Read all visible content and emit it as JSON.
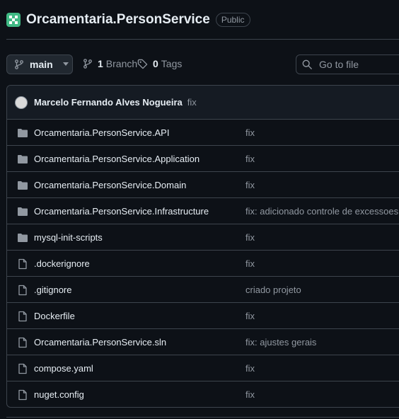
{
  "repo": {
    "name": "Orcamentaria.PersonService",
    "visibility": "Public",
    "avatar_color": "#3fb984"
  },
  "toolbar": {
    "branch_name": "main",
    "branch_count": "1",
    "branch_label": "Branch",
    "tag_count": "0",
    "tag_label": "Tags",
    "search_placeholder": "Go to file"
  },
  "latest_commit": {
    "author": "Marcelo Fernando Alves Nogueira",
    "message": "fix"
  },
  "files": [
    {
      "type": "folder",
      "name": "Orcamentaria.PersonService.API",
      "message": "fix"
    },
    {
      "type": "folder",
      "name": "Orcamentaria.PersonService.Application",
      "message": "fix"
    },
    {
      "type": "folder",
      "name": "Orcamentaria.PersonService.Domain",
      "message": "fix"
    },
    {
      "type": "folder",
      "name": "Orcamentaria.PersonService.Infrastructure",
      "message": "fix: adicionado controle de excessoes"
    },
    {
      "type": "folder",
      "name": "mysql-init-scripts",
      "message": "fix"
    },
    {
      "type": "file",
      "name": ".dockerignore",
      "message": "fix"
    },
    {
      "type": "file",
      "name": ".gitignore",
      "message": "criado projeto"
    },
    {
      "type": "file",
      "name": "Dockerfile",
      "message": "fix"
    },
    {
      "type": "file",
      "name": "Orcamentaria.PersonService.sln",
      "message": "fix: ajustes gerais"
    },
    {
      "type": "file",
      "name": "compose.yaml",
      "message": "fix"
    },
    {
      "type": "file",
      "name": "nuget.config",
      "message": "fix"
    }
  ],
  "colors": {
    "background": "#0d1117",
    "border": "#3d444d",
    "muted_text": "#9198a1",
    "icon": "#9198a1"
  }
}
